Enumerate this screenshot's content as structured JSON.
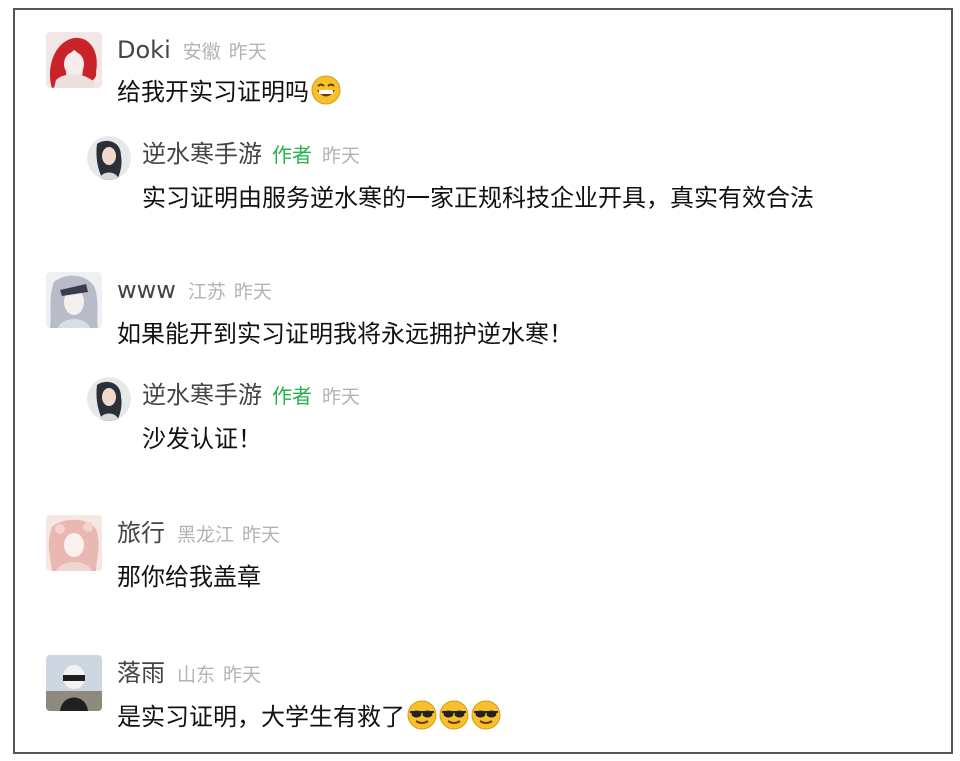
{
  "comments": [
    {
      "name": "Doki",
      "region": "安徽",
      "time": "昨天",
      "text": "给我开实习证明吗",
      "emoji": "grinning-face-icon",
      "reply": {
        "name": "逆水寒手游",
        "tag": "作者",
        "time": "昨天",
        "text": "实习证明由服务逆水寒的一家正规科技企业开具，真实有效合法"
      }
    },
    {
      "name": "www",
      "region": "江苏",
      "time": "昨天",
      "text": "如果能开到实习证明我将永远拥护逆水寒！",
      "reply": {
        "name": "逆水寒手游",
        "tag": "作者",
        "time": "昨天",
        "text": "沙发认证！"
      }
    },
    {
      "name": "旅行",
      "region": "黑龙江",
      "time": "昨天",
      "text": "那你给我盖章"
    },
    {
      "name": "落雨",
      "region": "山东",
      "time": "昨天",
      "text": "是实习证明，大学生有救了",
      "emoji": "sunglasses-face-icon x3"
    }
  ],
  "colors": {
    "author_tag": "#22b34a",
    "meta_gray": "#b3b3b3",
    "name": "#444444",
    "frame_border": "#555555"
  }
}
